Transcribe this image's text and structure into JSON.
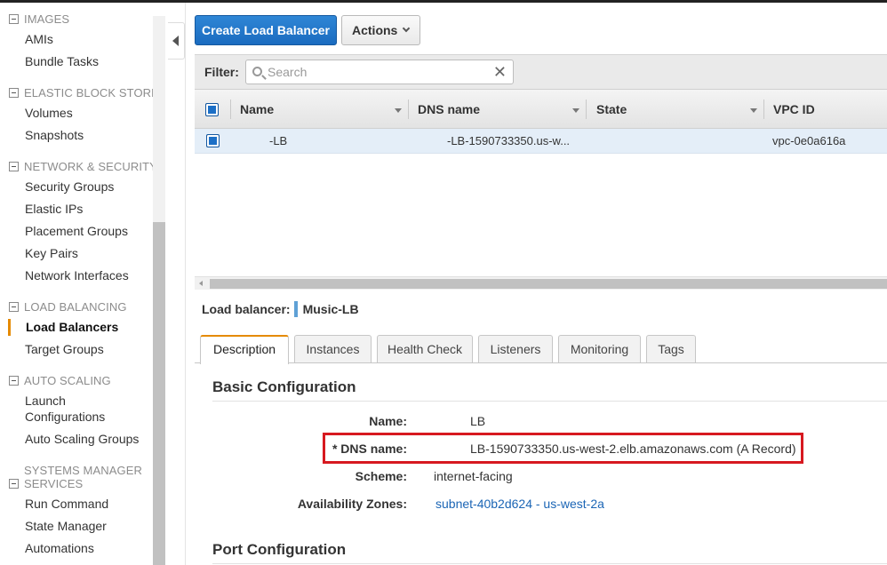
{
  "sidebar": {
    "sections": [
      {
        "header": "IMAGES",
        "items": [
          "AMIs",
          "Bundle Tasks"
        ]
      },
      {
        "header": "ELASTIC BLOCK STORE",
        "items": [
          "Volumes",
          "Snapshots"
        ]
      },
      {
        "header": "NETWORK & SECURITY",
        "items": [
          "Security Groups",
          "Elastic IPs",
          "Placement Groups",
          "Key Pairs",
          "Network Interfaces"
        ]
      },
      {
        "header": "LOAD BALANCING",
        "items": [
          "Load Balancers",
          "Target Groups"
        ]
      },
      {
        "header": "AUTO SCALING",
        "items": [
          "Launch Configurations",
          "Auto Scaling Groups"
        ]
      },
      {
        "header_line1": "SYSTEMS MANAGER",
        "header_line2": "SERVICES",
        "items": [
          "Run Command",
          "State Manager",
          "Automations"
        ]
      }
    ],
    "active_item": "Load Balancers"
  },
  "toolbar": {
    "create_label": "Create Load Balancer",
    "actions_label": "Actions"
  },
  "filter": {
    "label": "Filter:",
    "placeholder": "Search",
    "value": ""
  },
  "table": {
    "columns": [
      "Name",
      "DNS name",
      "State",
      "VPC ID"
    ],
    "rows": [
      {
        "name": "-LB",
        "dns_name": "-LB-1590733350.us-w...",
        "state": "",
        "vpc_id": "vpc-0e0a616a"
      }
    ]
  },
  "detail": {
    "lb_label": "Load balancer:",
    "lb_name": "Music-LB",
    "tabs": [
      "Description",
      "Instances",
      "Health Check",
      "Listeners",
      "Monitoring",
      "Tags"
    ],
    "active_tab": "Description",
    "basic_config_title": "Basic Configuration",
    "fields": {
      "name_label": "Name:",
      "name_value": "LB",
      "dns_label": "* DNS name:",
      "dns_value": "LB-1590733350.us-west-2.elb.amazonaws.com (A Record)",
      "scheme_label": "Scheme:",
      "scheme_value": "internet-facing",
      "az_label": "Availability Zones:",
      "az_value": "subnet-40b2d624 - us-west-2a"
    },
    "port_config_title": "Port Configuration"
  },
  "colors": {
    "primary_button": "#1a6bbf",
    "active_accent": "#e58a00",
    "highlight_box": "#d71920",
    "link": "#1b65b5",
    "selected_row": "#e4eef8"
  }
}
